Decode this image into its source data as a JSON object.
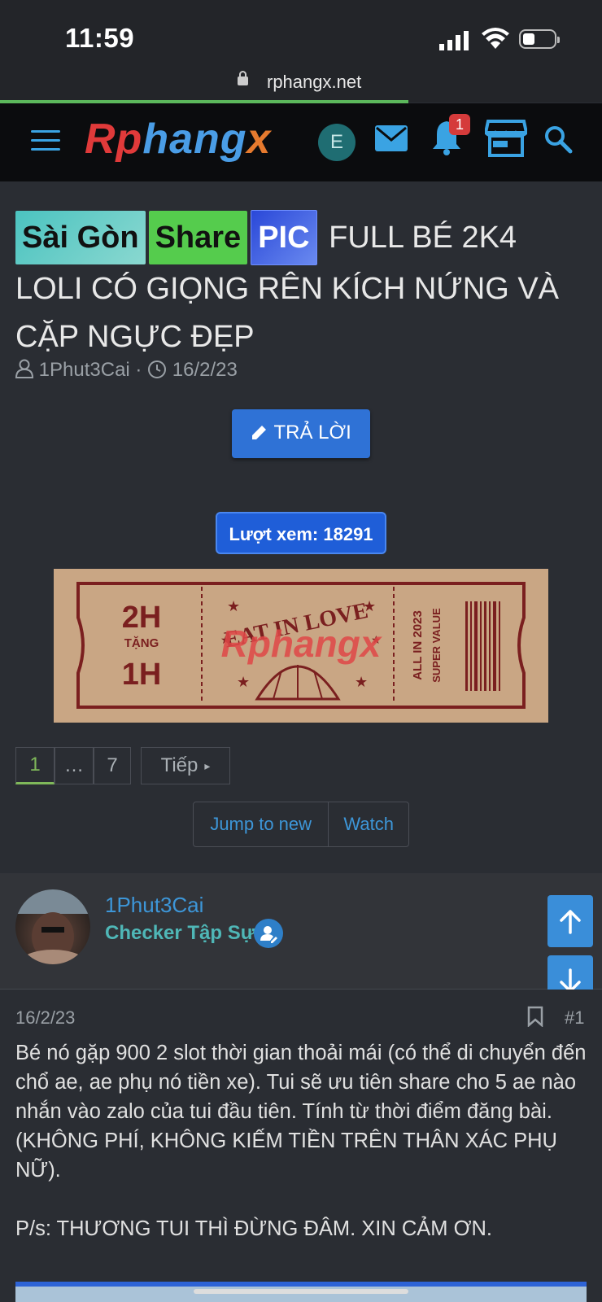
{
  "status": {
    "time": "11:59"
  },
  "browser": {
    "url": "rphangx.net"
  },
  "header": {
    "logo": {
      "p1": "Rp",
      "p2": "hang",
      "p3": "x"
    },
    "user_initial": "E",
    "notification_count": "1"
  },
  "thread": {
    "prefixes": [
      "Sài Gòn",
      "Share",
      "PIC"
    ],
    "title": " FULL BÉ 2K4 LOLI CÓ GIỌNG RÊN KÍCH NỨNG VÀ CẶP NGỰC ĐẸP",
    "author": "1Phut3Cai",
    "date": "16/2/23",
    "reply_label": "TRẢ LỜI",
    "views_label": "Lượt xem: 18291"
  },
  "banner": {
    "left_top": "2H",
    "left_mid": "TẶNG",
    "left_bot": "1H",
    "center": "EAT IN LOVE",
    "right1": "ALL IN 2023",
    "right2": "SUPER VALUE",
    "watermark": "Rphangx"
  },
  "pagination": {
    "pages": [
      "1",
      "…",
      "7"
    ],
    "next": "Tiếp"
  },
  "thread_actions": {
    "jump": "Jump to new",
    "watch": "Watch"
  },
  "post": {
    "username": "1Phut3Cai",
    "user_title": "Checker Tập Sự",
    "date": "16/2/23",
    "number": "#1",
    "body": "Bé nó gặp 900 2 slot thời gian thoải mái (có thể di chuyển đến chổ ae, ae phụ nó tiền xe). Tui sẽ ưu tiên share cho 5 ae nào nhắn vào zalo của tui đầu tiên. Tính từ thời điểm đăng bài. (KHÔNG PHÍ, KHÔNG KIẾM TIỀN TRÊN THÂN XÁC PHỤ NỮ).",
    "ps": "P/s: THƯƠNG TUI THÌ ĐỪNG ĐÂM. XIN CẢM ƠN."
  }
}
